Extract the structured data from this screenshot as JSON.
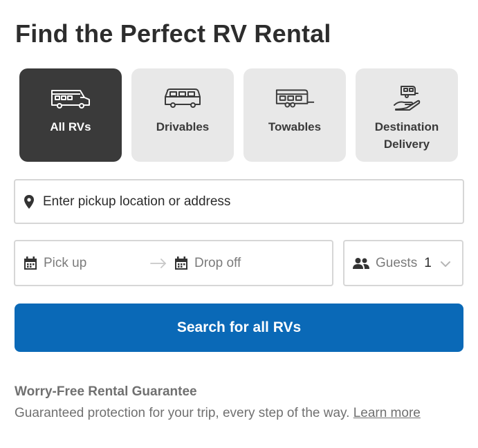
{
  "page": {
    "title": "Find the Perfect RV Rental"
  },
  "categories": [
    {
      "label": "All RVs",
      "icon": "motorhome-icon",
      "selected": true
    },
    {
      "label": "Drivables",
      "icon": "van-icon",
      "selected": false
    },
    {
      "label": "Towables",
      "icon": "travel-trailer-icon",
      "selected": false
    },
    {
      "label": "Destination Delivery",
      "icon": "delivery-hand-icon",
      "selected": false
    }
  ],
  "location": {
    "placeholder": "Enter pickup location or address",
    "icon": "map-pin-icon"
  },
  "dates": {
    "pickup_placeholder": "Pick up",
    "dropoff_placeholder": "Drop off",
    "icon": "calendar-icon",
    "separator_icon": "arrow-right-icon"
  },
  "guests": {
    "label": "Guests",
    "count": "1",
    "icon": "people-icon",
    "dropdown_icon": "chevron-down-icon"
  },
  "search_button": {
    "label": "Search for all RVs",
    "color": "#0a69b7"
  },
  "guarantee": {
    "title": "Worry-Free Rental Guarantee",
    "text": "Guaranteed protection for your trip, every step of the way.",
    "link_label": "Learn more"
  },
  "colors": {
    "selected_tile": "#3a3a3a",
    "tile": "#e8e8e8",
    "border": "#d6d6d6",
    "muted_text": "#707070"
  }
}
